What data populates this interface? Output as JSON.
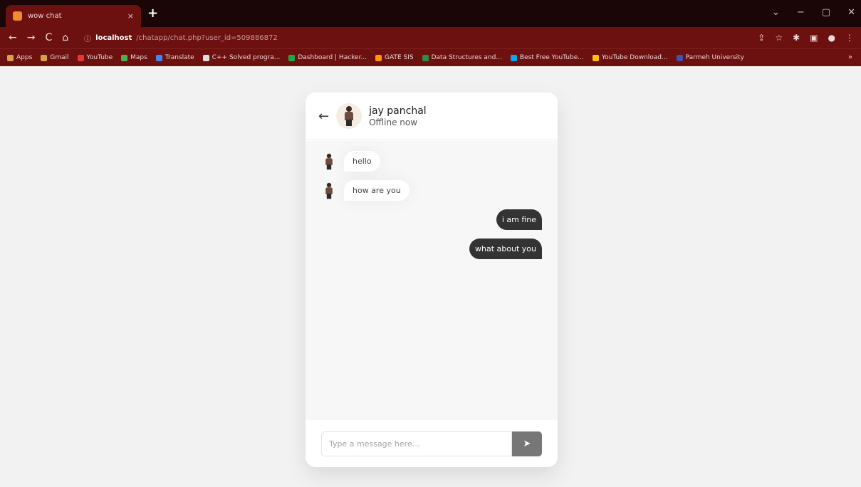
{
  "browser": {
    "tab_title": "wow chat",
    "tab_close": "×",
    "new_tab": "+",
    "window_controls": [
      "⌄",
      "−",
      "▢",
      "✕"
    ],
    "nav_icons": [
      "←",
      "→",
      "C",
      "⌂"
    ],
    "url_host": "localhost",
    "url_path": "/chatapp/chat.php?user_id=509886872",
    "bookmarks": [
      "Apps",
      "Gmail",
      "YouTube",
      "Maps",
      "Translate",
      "C++ Solved progra...",
      "Dashboard | Hacker...",
      "GATE SIS",
      "Data Structures and...",
      "Best Free YouTube...",
      "YouTube Download...",
      "Parmeh University"
    ],
    "bookmarks_more": "»"
  },
  "chat": {
    "back_icon": "←",
    "user_name": "jay panchal",
    "user_status": "Offline now",
    "messages": [
      {
        "direction": "incoming",
        "text": "hello"
      },
      {
        "direction": "incoming",
        "text": "how are you"
      },
      {
        "direction": "outgoing",
        "text": "i am fine"
      },
      {
        "direction": "outgoing",
        "text": "what about you"
      }
    ],
    "input_placeholder": "Type a message here...",
    "send_icon": "➤"
  },
  "colors": {
    "browser_frame": "#6d1010",
    "outgoing_bubble": "#333333",
    "send_button": "#777777",
    "page_background": "#f2f2f2"
  }
}
